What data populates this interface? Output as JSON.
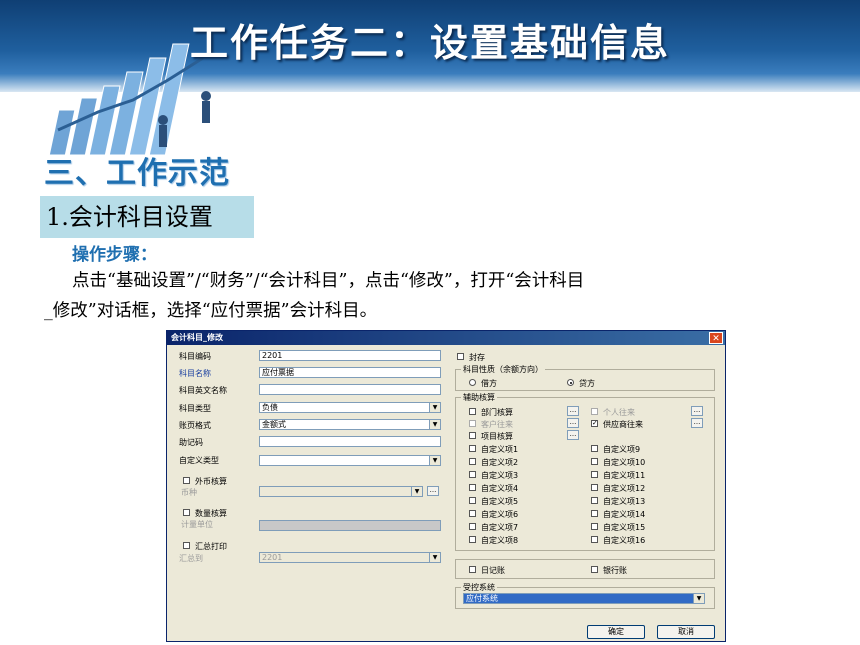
{
  "slide": {
    "title": "工作任务二：设置基础信息",
    "section": "三、工作示范",
    "subsection": "1.会计科目设置",
    "steps_heading": "操作步骤：",
    "para_line1": "点击“基础设置”/“财务”/“会计科目”，点击“修改”，打开“会计科目",
    "para_line2": "_修改”对话框，选择“应付票据”会计科目。"
  },
  "dialog": {
    "title": "会计科目_修改",
    "close_glyph": "✕",
    "left": {
      "code_label": "科目编码",
      "code_value": "2201",
      "name_label": "科目名称",
      "name_value": "应付票据",
      "en_name_label": "科目英文名称",
      "en_name_value": "",
      "type_label": "科目类型",
      "type_value": "负债",
      "format_label": "账页格式",
      "format_value": "金额式",
      "mnemonic_label": "助记码",
      "mnemonic_value": "",
      "custom_type_label": "自定义类型",
      "custom_type_value": "",
      "foreign_label": "外币核算",
      "currency_label": "币种",
      "currency_value": "",
      "qty_label": "数量核算",
      "unit_label": "计量单位",
      "unit_value": "",
      "summary_label": "汇总打印",
      "summary_to_label": "汇总到",
      "summary_to_value": "2201"
    },
    "right": {
      "sealed_label": "封存",
      "nature_group": "科目性质（余额方向）",
      "debit_label": "借方",
      "credit_label": "贷方",
      "aux_group": "辅助核算",
      "aux": {
        "dept": "部门核算",
        "personal": "个人往来",
        "customer": "客户往来",
        "supplier": "供应商往来",
        "project": "项目核算"
      },
      "custom_left": [
        "自定义项1",
        "自定义项2",
        "自定义项3",
        "自定义项4",
        "自定义项5",
        "自定义项6",
        "自定义项7",
        "自定义项8"
      ],
      "custom_right": [
        "自定义项9",
        "自定义项10",
        "自定义项11",
        "自定义项12",
        "自定义项13",
        "自定义项14",
        "自定义项15",
        "自定义项16"
      ],
      "journal_label": "日记账",
      "bank_label": "银行账",
      "control_group": "受控系统",
      "control_value": "应付系统"
    },
    "dots": "...",
    "check_mark": "✓",
    "arrow": "▼",
    "ok_label": "确定",
    "cancel_label": "取消"
  },
  "colors": {
    "banner": "#1f5f9e",
    "accent": "#1f6fb0",
    "sub_bg": "#b7dde8",
    "dialog_bg": "#ece9d8"
  }
}
